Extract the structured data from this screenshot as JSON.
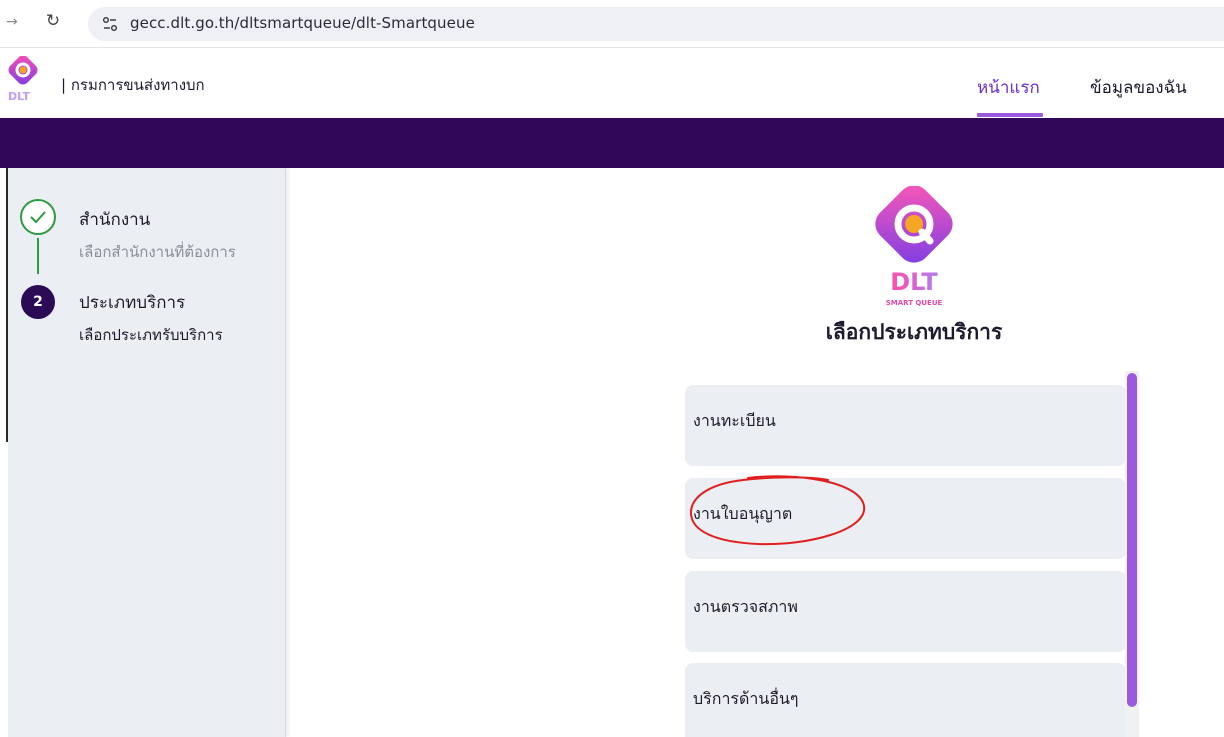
{
  "browser": {
    "url": "gecc.dlt.go.th/dltsmartqueue/dlt-Smartqueue",
    "icons": [
      "forward-icon",
      "reload-icon",
      "site-settings-icon"
    ]
  },
  "header": {
    "org_name": "| กรมการขนส่งทางบก",
    "nav": {
      "home_label": "หน้าแรก",
      "profile_label": "ข้อมูลของฉัน"
    },
    "logo_text": "DLT"
  },
  "sidebar": {
    "steps": [
      {
        "title": "สำนักงาน",
        "subtitle": "เลือกสำนักงานที่ต้องการ",
        "status": "completed"
      },
      {
        "number": "2",
        "title": "ประเภทบริการ",
        "subtitle": "เลือกประเภทรับบริการ",
        "status": "active"
      }
    ]
  },
  "main": {
    "logo_text": "DLT",
    "logo_subtext": "SMART QUEUE",
    "title": "เลือกประเภทบริการ",
    "services": [
      {
        "label": "งานทะเบียน"
      },
      {
        "label": "งานใบอนุญาต"
      },
      {
        "label": "งานตรวจสภาพ"
      },
      {
        "label": "บริการด้านอื่นๆ"
      }
    ]
  },
  "colors": {
    "brand_purple_dark": "#310859",
    "accent_purple": "#9b59e0",
    "step_done_green": "#2e9a41",
    "annotation_red": "#e02020"
  }
}
